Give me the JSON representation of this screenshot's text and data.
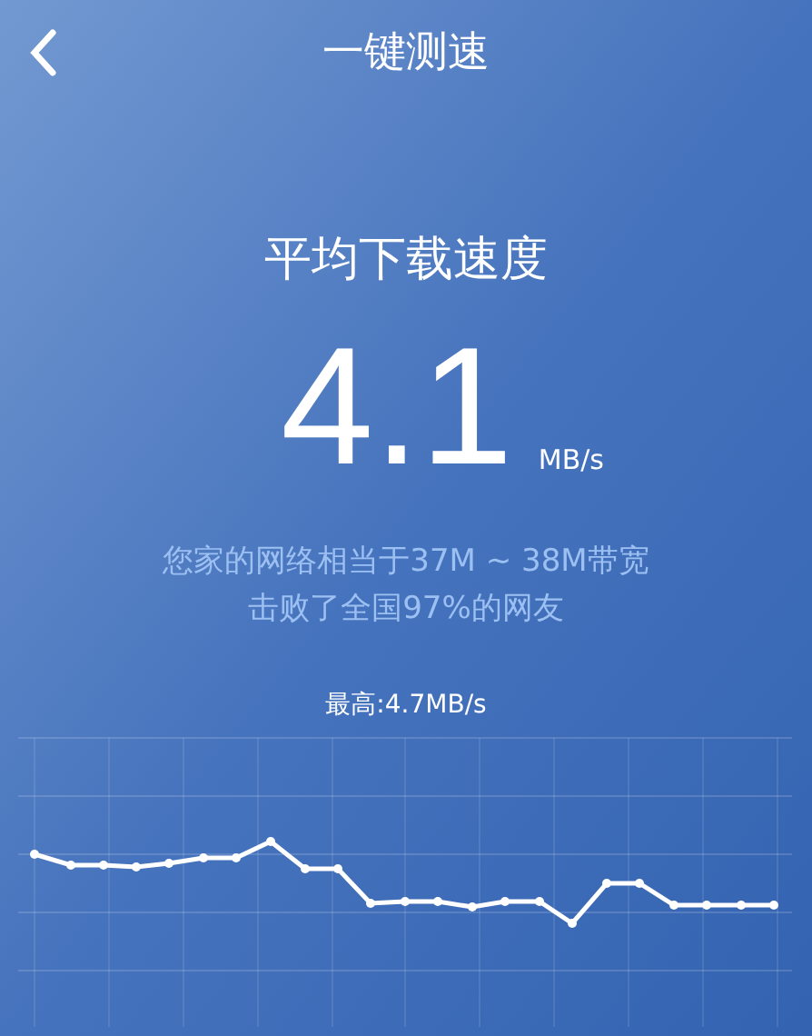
{
  "header": {
    "title": "一键测速"
  },
  "result": {
    "label": "平均下载速度",
    "value": "4.1",
    "unit": "MB/s"
  },
  "summary": [
    "您家的网络相当于37M ~ 38M带宽",
    "击败了全国97%的网友"
  ],
  "peak": "最高:4.7MB/s"
}
